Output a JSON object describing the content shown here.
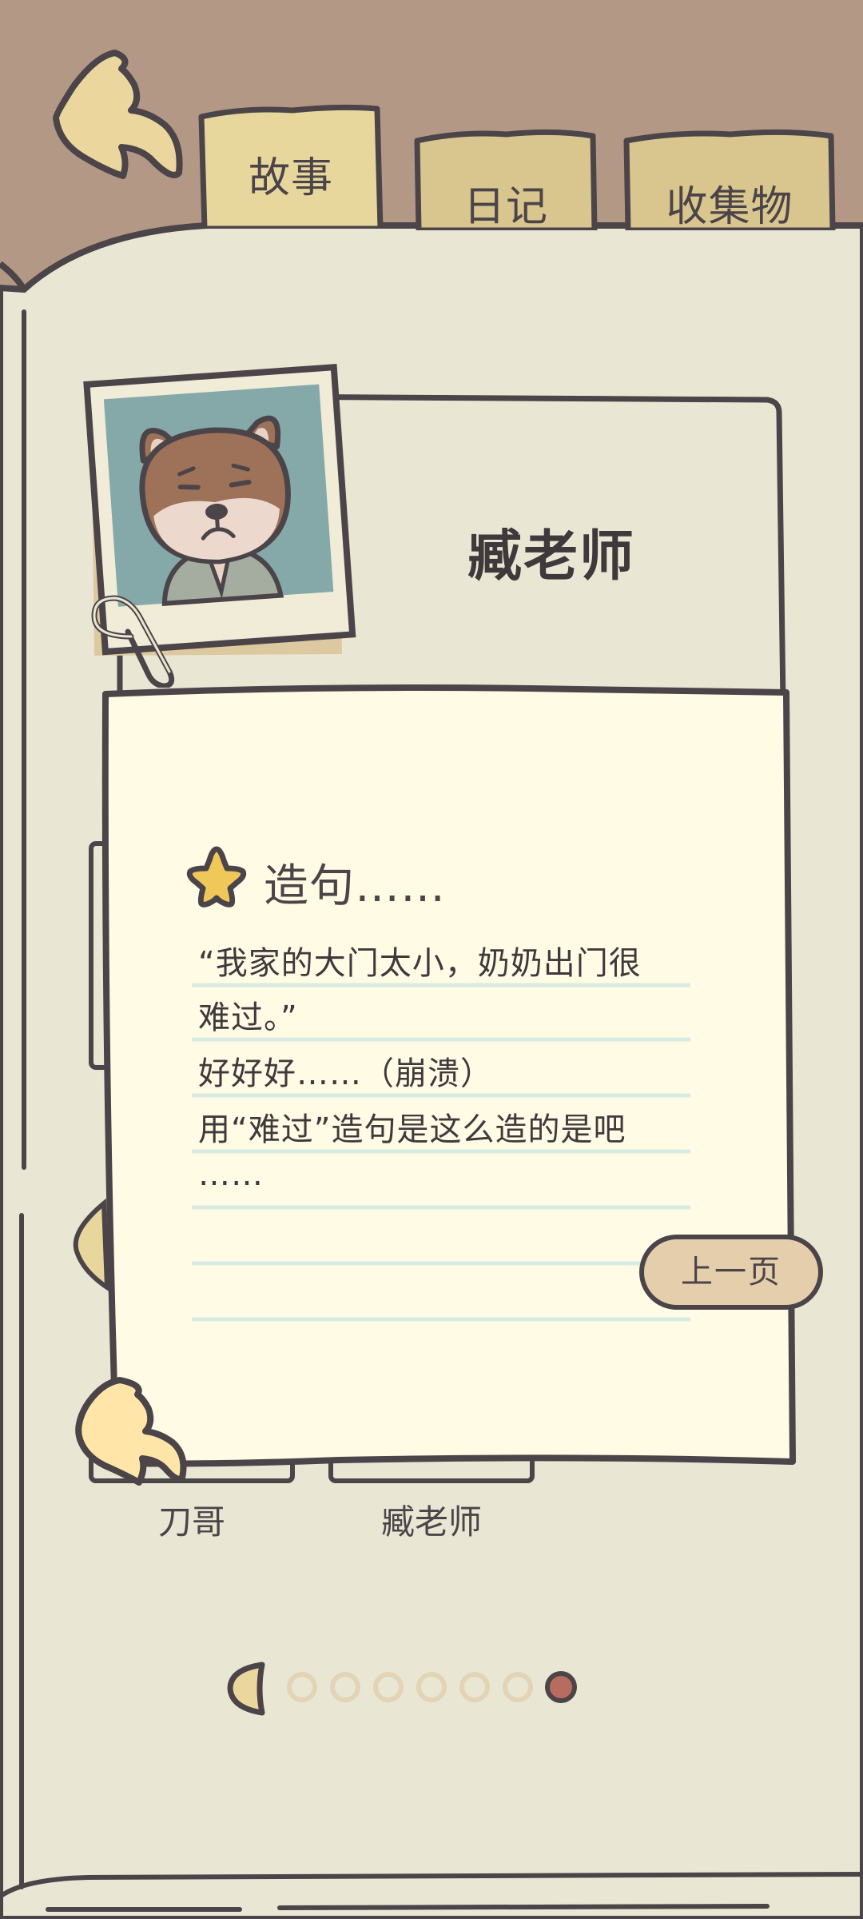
{
  "tabs": [
    {
      "label": "故事",
      "active": true
    },
    {
      "label": "日记",
      "active": false
    },
    {
      "label": "收集物",
      "active": false
    }
  ],
  "profile": {
    "name": "臧老师",
    "portrait": "shiba-dog-teacher-portrait"
  },
  "note": {
    "title": "造句……",
    "title_icon": "star-icon",
    "lines": [
      "“我家的大门太小，奶奶出门很",
      "难过。”",
      "好好好……（崩溃）",
      "用“难过”造句是这么造的是吧",
      "……"
    ],
    "prev_button": "上一页"
  },
  "character_cards": [
    {
      "label": "刀哥"
    },
    {
      "label": "臧老师"
    }
  ],
  "pagination": {
    "total_dots": 7,
    "current_page": 7
  },
  "colors": {
    "background_top": "#b39886",
    "page": "#e9e6d4",
    "note": "#fffbe5",
    "outline": "#4b4448",
    "tab": "#d9c58e",
    "tab_active": "#e8d79d",
    "accent": "#b86c5f"
  }
}
